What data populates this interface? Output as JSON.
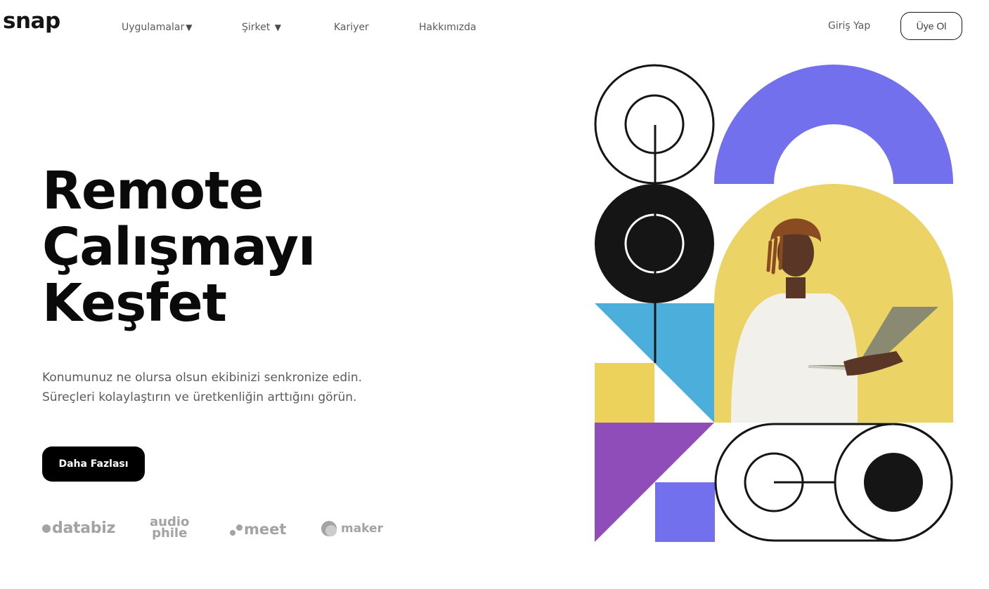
{
  "header": {
    "logo": "snap",
    "nav": [
      {
        "label": "Uygulamalar",
        "has_caret": true
      },
      {
        "label": "Şirket",
        "has_caret": true
      },
      {
        "label": "Kariyer",
        "has_caret": false
      },
      {
        "label": "Hakkımızda",
        "has_caret": false
      }
    ],
    "caret_glyph": "▼",
    "login_label": "Giriş Yap",
    "signup_label": "Üye Ol"
  },
  "hero": {
    "title_lines": [
      "Remote",
      "Çalışmayı",
      "Keşfet"
    ],
    "subtitle_lines": [
      "Konumunuz ne olursa olsun ekibinizi senkronize edin.",
      "Süreçleri kolaylaştırın ve üretkenliğin arttığını görün."
    ],
    "cta_label": "Daha Fazlası"
  },
  "clients": {
    "databiz": "databiz",
    "audiophile": [
      "audio",
      "phile"
    ],
    "meet": "meet",
    "maker": "maker"
  },
  "colors": {
    "violet": "#7270ed",
    "yellow": "#ecd25a",
    "photo_bg": "#ebd365",
    "blue": "#4caedb",
    "purple": "#8e4db8",
    "black": "#151515"
  }
}
